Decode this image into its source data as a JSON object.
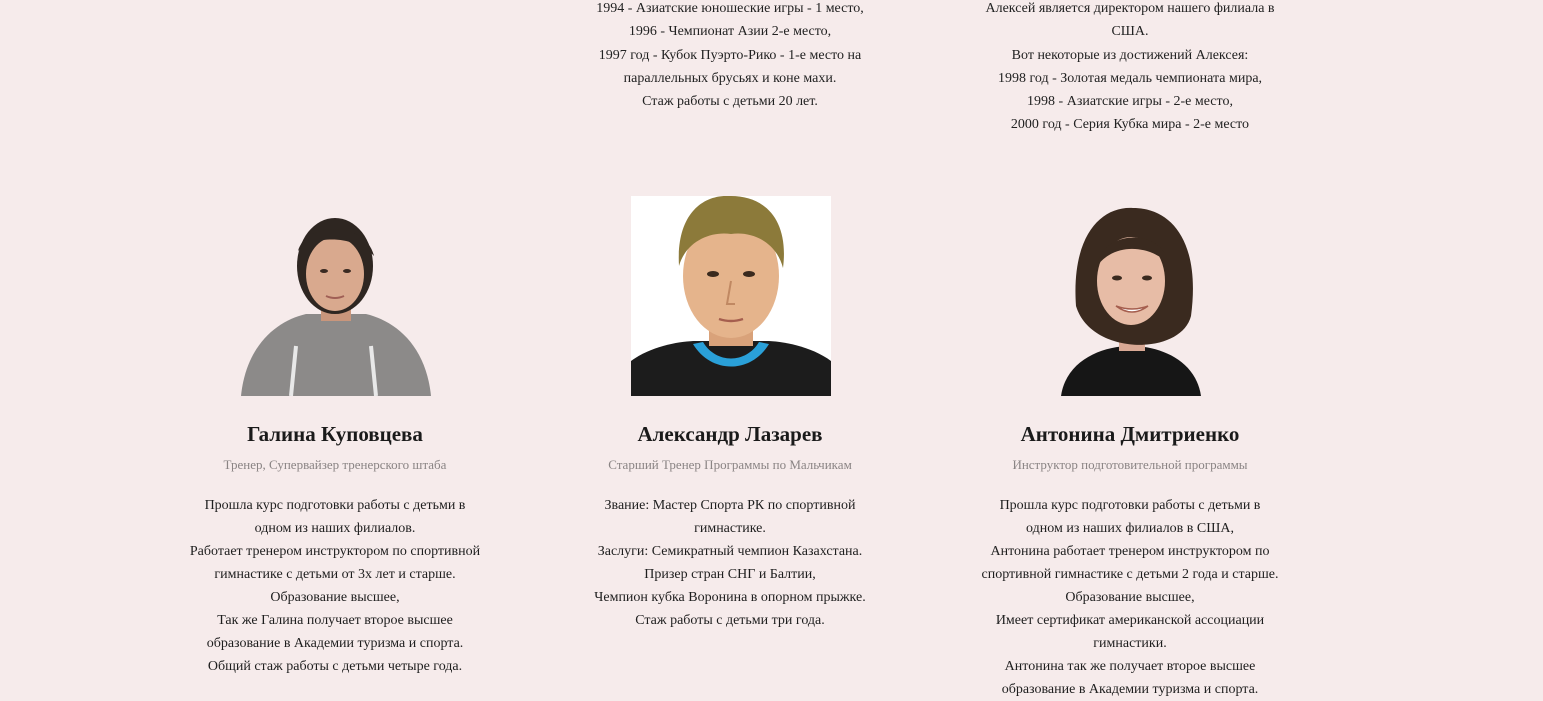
{
  "top": {
    "col2_lines": [
      "1994 - Азиатские юношеские игры - 1 место,",
      "1996 - Чемпионат Азии 2-е место,",
      "1997 год - Кубок Пуэрто-Рико - 1-е место на",
      "параллельных брусьях и коне махи.",
      "Стаж работы с детьми 20 лет."
    ],
    "col3_lines": [
      "Алексей является директором нашего филиала в",
      "США.",
      "Вот некоторые из достижений Алексея:",
      "1998 год - Золотая медаль чемпионата мира,",
      "1998 - Азиатские игры - 2-е место,",
      "2000 год - Серия Кубка мира - 2-е место"
    ]
  },
  "coaches": [
    {
      "name": "Галина Куповцева",
      "role": "Тренер, Супервайзер тренерского штаба",
      "photo_colors": {
        "background": "#ffffff",
        "hair": "#2e2621",
        "skin": "#d9a98e",
        "clothes": "#8c8a89"
      },
      "bio": [
        "Прошла курс подготовки работы с детьми в",
        "одном из наших филиалов.",
        "Работает тренером инструктором по спортивной",
        "гимнастике с детьми от 3х лет и старше.",
        "Образование высшее,",
        "Так же Галина получает второе высшее",
        "образование в Академии туризма и спорта.",
        "Общий стаж работы с детьми четыре года."
      ]
    },
    {
      "name": "Александр Лазарев",
      "role": "Старший Тренер Программы по Мальчикам",
      "photo_colors": {
        "background": "#ffffff",
        "hair": "#8c7a3a",
        "skin": "#e5b48c",
        "clothes": "#1c1c1c",
        "collar": "#2aa0d8"
      },
      "bio": [
        "Звание: Мастер Спорта РК по спортивной",
        "гимнастике.",
        "Заслуги: Семикратный чемпион Казахстана.",
        "Призер стран СНГ и Балтии,",
        "Чемпион кубка Воронина в опорном прыжке.",
        "Стаж работы с детьми три года."
      ]
    },
    {
      "name": "Антонина Дмитриенко",
      "role": "Инструктор подготовительной программы",
      "photo_colors": {
        "background": "#ffffff",
        "hair": "#3a2a1f",
        "skin": "#e7bca6",
        "clothes": "#161616"
      },
      "bio": [
        "Прошла курс подготовки работы с детьми в",
        "одном из наших филиалов в США,",
        "Антонина работает тренером инструктором по",
        "спортивной гимнастике с детьми 2 года и старше.",
        "Образование высшее,",
        "Имеет сертификат американской ассоциации",
        "гимнастики.",
        "Антонина так же получает второе высшее",
        "образование в Академии туризма и спорта."
      ]
    }
  ]
}
